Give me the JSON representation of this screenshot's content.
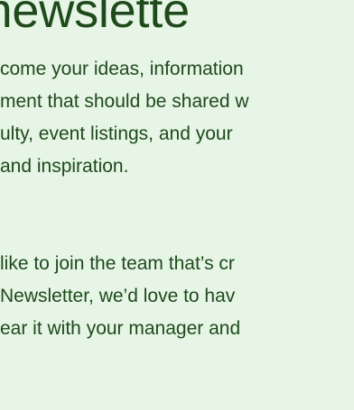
{
  "newsletter_page": {
    "heading": "s newslette",
    "intro_paragraph": {
      "lines": [
        "come your ideas, information",
        "ment that should be shared w",
        "ulty, event listings, and your",
        "and inspiration."
      ]
    },
    "join_paragraph": {
      "lines": [
        "like to join the team that’s cr",
        "Newsletter, we’d love to hav",
        "ear it with your manager and"
      ]
    }
  }
}
